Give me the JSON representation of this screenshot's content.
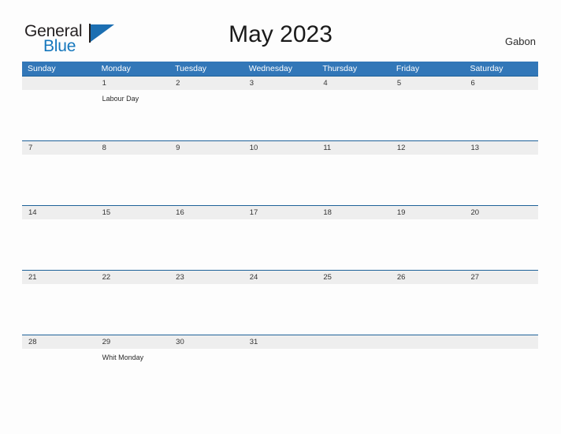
{
  "brand": {
    "name_part1": "General",
    "name_part2": "Blue",
    "logo_icon": "blue-triangle-icon"
  },
  "header": {
    "title": "May 2023",
    "region": "Gabon"
  },
  "colors": {
    "header_blue": "#3277b8",
    "strip_gray": "#eeeeee",
    "strip_border": "#1f6299",
    "logo_blue": "#1577bd",
    "page_background": "#fdfdfd"
  },
  "calendar": {
    "weekdays": [
      "Sunday",
      "Monday",
      "Tuesday",
      "Wednesday",
      "Thursday",
      "Friday",
      "Saturday"
    ],
    "weeks": [
      {
        "dates": [
          "",
          "1",
          "2",
          "3",
          "4",
          "5",
          "6"
        ],
        "events": [
          "",
          "Labour Day",
          "",
          "",
          "",
          "",
          ""
        ]
      },
      {
        "dates": [
          "7",
          "8",
          "9",
          "10",
          "11",
          "12",
          "13"
        ],
        "events": [
          "",
          "",
          "",
          "",
          "",
          "",
          ""
        ]
      },
      {
        "dates": [
          "14",
          "15",
          "16",
          "17",
          "18",
          "19",
          "20"
        ],
        "events": [
          "",
          "",
          "",
          "",
          "",
          "",
          ""
        ]
      },
      {
        "dates": [
          "21",
          "22",
          "23",
          "24",
          "25",
          "26",
          "27"
        ],
        "events": [
          "",
          "",
          "",
          "",
          "",
          "",
          ""
        ]
      },
      {
        "dates": [
          "28",
          "29",
          "30",
          "31",
          "",
          "",
          ""
        ],
        "events": [
          "",
          "Whit Monday",
          "",
          "",
          "",
          "",
          ""
        ]
      }
    ]
  }
}
